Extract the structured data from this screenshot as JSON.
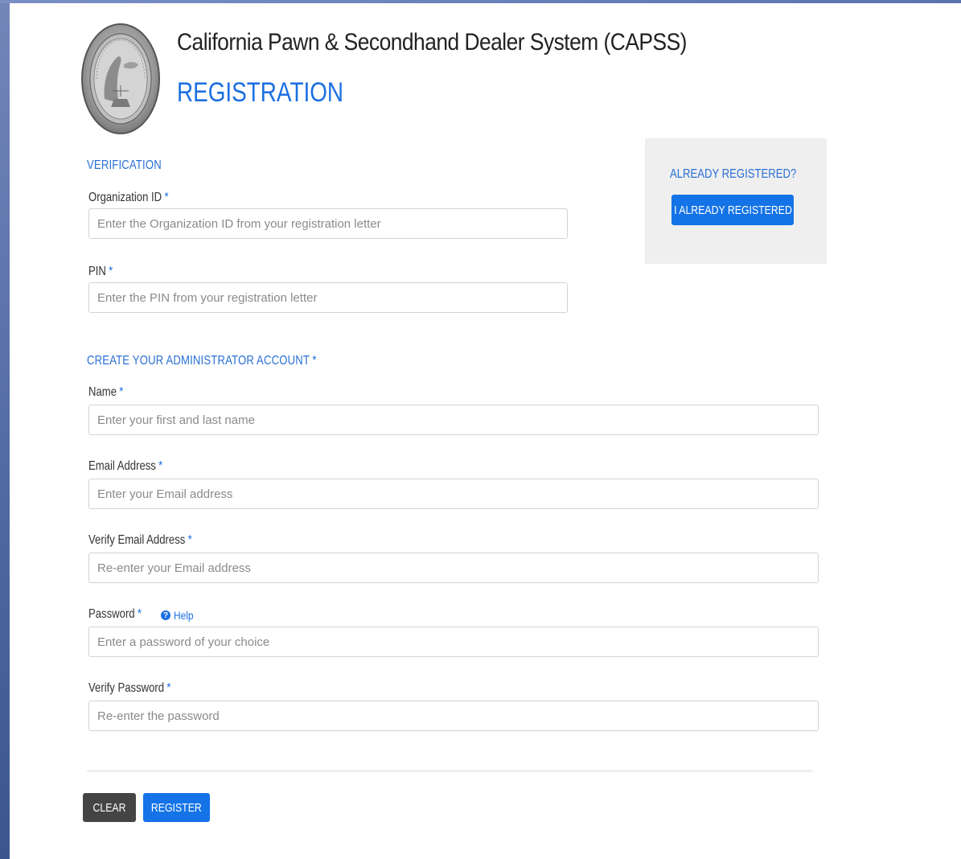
{
  "header": {
    "app_title": "California Pawn & Secondhand Dealer System (CAPSS)",
    "page_title": "REGISTRATION"
  },
  "verification": {
    "heading": "VERIFICATION",
    "org_id": {
      "label": "Organization ID",
      "placeholder": "Enter the Organization ID from your registration letter",
      "value": ""
    },
    "pin": {
      "label": "PIN",
      "placeholder": "Enter the PIN from your registration letter",
      "value": ""
    }
  },
  "account": {
    "heading": "CREATE YOUR ADMINISTRATOR ACCOUNT",
    "name": {
      "label": "Name",
      "placeholder": "Enter your first and last name",
      "value": ""
    },
    "email": {
      "label": "Email Address",
      "placeholder": "Enter your Email address",
      "value": ""
    },
    "verify_email": {
      "label": "Verify Email Address",
      "placeholder": "Re-enter your Email address",
      "value": ""
    },
    "password": {
      "label": "Password",
      "placeholder": "Enter a password of your choice",
      "value": "",
      "help": "Help"
    },
    "verify_password": {
      "label": "Verify Password",
      "placeholder": "Re-enter the password",
      "value": ""
    }
  },
  "required_marker": "*",
  "aside": {
    "heading": "ALREADY REGISTERED?",
    "button": "I ALREADY REGISTERED"
  },
  "actions": {
    "clear": "CLEAR",
    "register": "REGISTER"
  },
  "colors": {
    "accent": "#1473e6",
    "heading": "#2a6fd6",
    "dark_button": "#444444",
    "aside_bg": "#efefef"
  },
  "icons": {
    "help": "question-circle-icon",
    "seal": "state-seal-logo"
  }
}
